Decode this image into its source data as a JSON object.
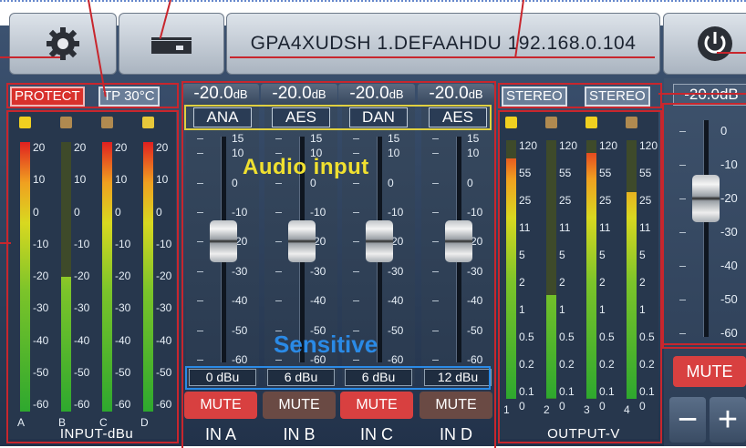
{
  "header": {
    "device_title": "GPA4XUDSH  1.DEFAAHDU  192.168.0.104"
  },
  "status": {
    "protect": "PROTECT",
    "temperature": "TP 30°C",
    "output_mode_1": "STEREO",
    "output_mode_2": "STEREO"
  },
  "input_channels": [
    {
      "gain_db": "-20.0",
      "unit": "dB",
      "source": "ANA",
      "sensitivity": "0 dBu",
      "mute": "MUTE",
      "name": "IN A",
      "fader_db": -20
    },
    {
      "gain_db": "-20.0",
      "unit": "dB",
      "source": "AES",
      "sensitivity": "6 dBu",
      "mute": "MUTE",
      "name": "IN B",
      "fader_db": -20
    },
    {
      "gain_db": "-20.0",
      "unit": "dB",
      "source": "DAN",
      "sensitivity": "6 dBu",
      "mute": "MUTE",
      "name": "IN C",
      "fader_db": -20
    },
    {
      "gain_db": "-20.0",
      "unit": "dB",
      "source": "AES",
      "sensitivity": "12 dBu",
      "mute": "MUTE",
      "name": "IN D",
      "fader_db": -20
    }
  ],
  "fader_scale": [
    "15",
    "10",
    "0",
    "-10",
    "-20",
    "-30",
    "-40",
    "-50",
    "-60"
  ],
  "input_meter": {
    "label": "INPUT-dBu",
    "scale": [
      "20",
      "10",
      "0",
      "-10",
      "-20",
      "-30",
      "-40",
      "-50",
      "-60"
    ],
    "channels": [
      "A",
      "B",
      "C",
      "D"
    ],
    "levels": [
      1.0,
      0.5,
      1.0,
      1.0
    ]
  },
  "output_meter": {
    "label": "OUTPUT-V",
    "scale": [
      "120",
      "55",
      "25",
      "11",
      "5",
      "2",
      "1",
      "0.5",
      "0.2",
      "0.1"
    ],
    "channels": [
      "1",
      "2",
      "3",
      "4"
    ],
    "zero": "0",
    "levels": [
      0.93,
      0.4,
      0.95,
      0.8
    ]
  },
  "master": {
    "gain": "-20.0dB",
    "scale": [
      "0",
      "-10",
      "-20",
      "-30",
      "-40",
      "-50",
      "-60"
    ],
    "mute": "MUTE",
    "minus": "−",
    "plus": "+",
    "fader_db": -20
  },
  "annotations": {
    "audio_input": "Audio input",
    "sensitive": "Sensitive"
  },
  "colors": {
    "panel": "#2c3d55",
    "mute_active": "#d84040",
    "mute_idle": "#6a4a44",
    "annotation_red": "#c8262d",
    "annotation_yellow": "#e8dc32",
    "annotation_blue": "#2a8ae6"
  }
}
